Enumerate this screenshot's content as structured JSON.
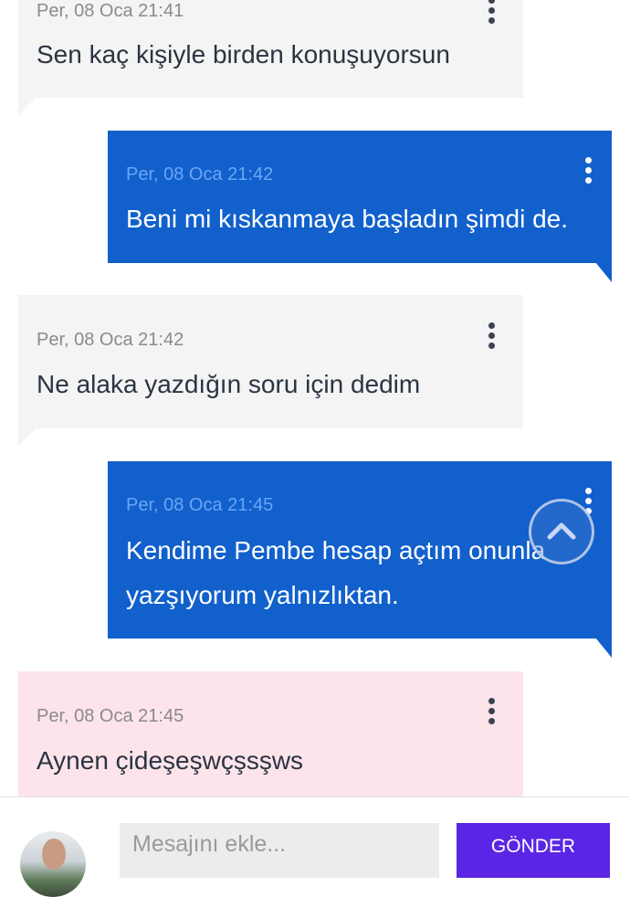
{
  "messages": [
    {
      "direction": "incoming",
      "timestamp": "Per, 08 Oca 21:41",
      "text": "Sen kaç kişiyle birden konuşuyorsun"
    },
    {
      "direction": "outgoing",
      "timestamp": "Per, 08 Oca 21:42",
      "text": "Beni mi kıskanmaya başladın şimdi de."
    },
    {
      "direction": "incoming",
      "timestamp": "Per, 08 Oca 21:42",
      "text": "Ne alaka yazdığın soru için dedim"
    },
    {
      "direction": "outgoing",
      "timestamp": "Per, 08 Oca 21:45",
      "text_line1": "Kendime Pembe hesap açtım onunla",
      "text_line2": "yazşıyorum yalnızlıktan."
    },
    {
      "direction": "incoming",
      "timestamp": "Per, 08 Oca 21:45",
      "text": "Aynen çideşeşwçşsşws",
      "highlight": "pink"
    }
  ],
  "icons": {
    "menu": "vertical-dots-icon",
    "scroll_top": "chevron-up-icon"
  },
  "composer": {
    "placeholder": "Mesajını ekle...",
    "send_label": "GÖNDER"
  },
  "colors": {
    "incoming_bg": "#f4f4f4",
    "incoming_highlight_bg": "#fde4ea",
    "outgoing_bg": "#1160cc",
    "send_button": "#5a25e5"
  }
}
